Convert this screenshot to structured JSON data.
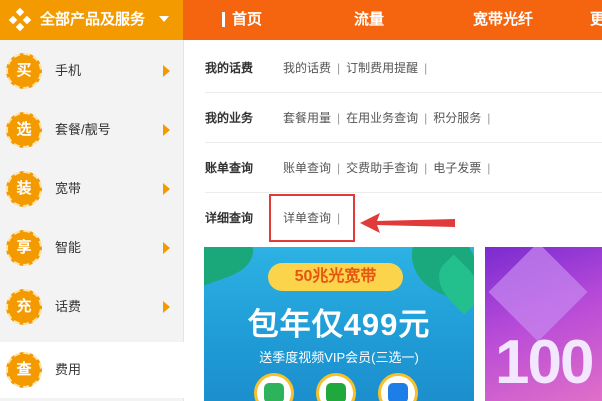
{
  "top_nav": {
    "all_products": "全部产品及服务",
    "items": [
      "首页",
      "流量",
      "宽带光纤",
      "更"
    ]
  },
  "sidebar": {
    "items": [
      {
        "badge": "买",
        "label": "手机"
      },
      {
        "badge": "选",
        "label": "套餐/靓号"
      },
      {
        "badge": "装",
        "label": "宽带"
      },
      {
        "badge": "享",
        "label": "智能"
      },
      {
        "badge": "充",
        "label": "话费"
      },
      {
        "badge": "查",
        "label": "费用"
      }
    ]
  },
  "dropdown": {
    "rows": [
      {
        "category": "我的话费",
        "links": [
          "我的话费",
          "订制费用提醒"
        ]
      },
      {
        "category": "我的业务",
        "links": [
          "套餐用量",
          "在用业务查询",
          "积分服务"
        ]
      },
      {
        "category": "账单查询",
        "links": [
          "账单查询",
          "交费助手查询",
          "电子发票"
        ]
      },
      {
        "category": "详细查询",
        "links": [
          "详单查询"
        ]
      }
    ],
    "separator": "|"
  },
  "banner1": {
    "pill": "50兆光宽带",
    "headline": "包年仅499元",
    "subline": "送季度视频VIP会员(三选一)"
  },
  "banner2": {
    "number": "100"
  },
  "colors": {
    "nav_orange": "#f5650f",
    "accent_orange": "#f39a00",
    "highlight_red": "#e03a3a"
  }
}
